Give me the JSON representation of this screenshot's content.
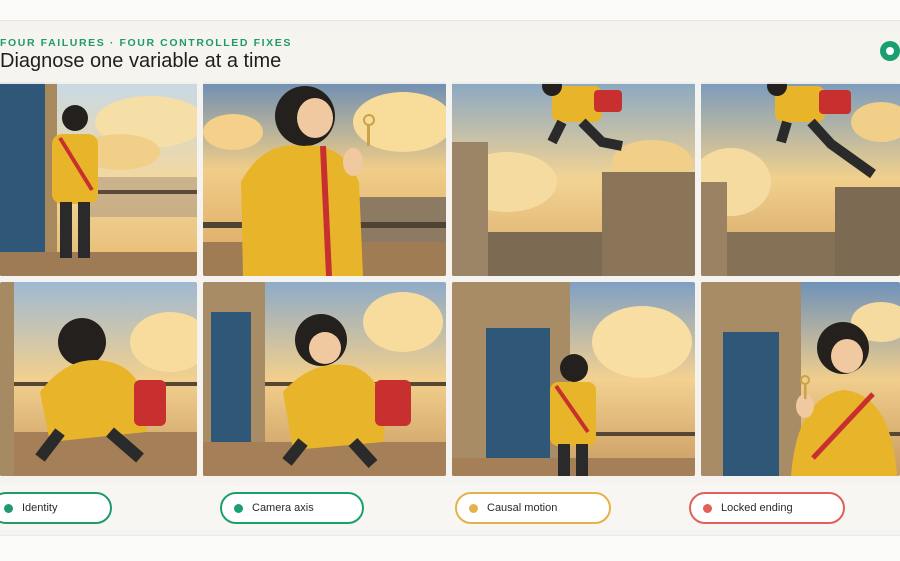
{
  "header": {
    "eyebrow": "FOUR FAILURES · FOUR CONTROLLED FIXES",
    "title": "Diagnose one variable at a time"
  },
  "panels": [
    {
      "row": "top",
      "subject": "boy in yellow hoodie standing by blue door"
    },
    {
      "row": "top",
      "subject": "boy in yellow hoodie holding a key"
    },
    {
      "row": "top",
      "subject": "boy jumping between rooftops"
    },
    {
      "row": "top",
      "subject": "boy jumping between rooftops"
    },
    {
      "row": "bottom",
      "subject": "boy crouching with red bag"
    },
    {
      "row": "bottom",
      "subject": "boy crouching by blue door"
    },
    {
      "row": "bottom",
      "subject": "boy standing by blue door"
    },
    {
      "row": "bottom",
      "subject": "boy smiling holding key by blue door"
    }
  ],
  "labels": [
    {
      "text": "Identity",
      "color": "#1f9a6d"
    },
    {
      "text": "Camera axis",
      "color": "#1aa070"
    },
    {
      "text": "Causal motion",
      "color": "#e3b24a"
    },
    {
      "text": "Locked ending",
      "color": "#e0605a"
    }
  ],
  "colors": {
    "accent": "#1aa070",
    "hoodie": "#e8b52a",
    "bag": "#c83030",
    "door": "#2f5878",
    "sky": "#f2c97a"
  }
}
